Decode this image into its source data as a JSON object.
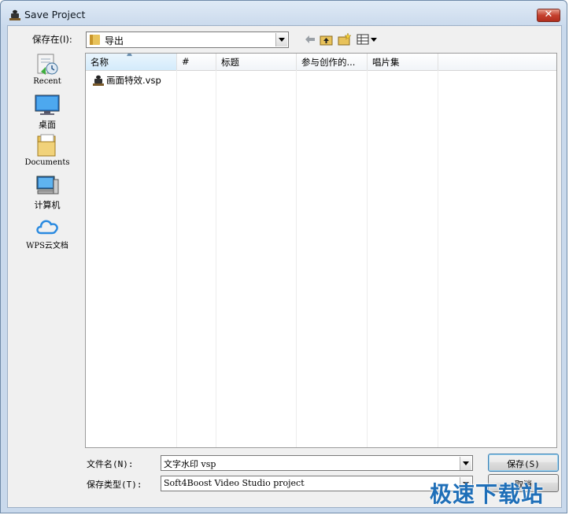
{
  "window": {
    "title": "Save Project"
  },
  "toolbar": {
    "save_in_label": "保存在(I):",
    "current_folder": "导出"
  },
  "places": [
    {
      "label": "Recent",
      "icon": "recent-places-icon"
    },
    {
      "label": "桌面",
      "icon": "desktop-icon"
    },
    {
      "label": "Documents",
      "icon": "documents-folder-icon"
    },
    {
      "label": "计算机",
      "icon": "computer-icon"
    },
    {
      "label": "WPS云文档",
      "icon": "cloud-icon"
    }
  ],
  "columns": [
    {
      "label": "名称",
      "sorted": true
    },
    {
      "label": "#"
    },
    {
      "label": "标题"
    },
    {
      "label": "参与创作的..."
    },
    {
      "label": "唱片集"
    }
  ],
  "files": [
    {
      "name": "画面特效.vsp",
      "icon": "vsp-project-icon"
    }
  ],
  "form": {
    "filename_label": "文件名(N):",
    "filename_value": "文字水印 vsp",
    "filetype_label": "保存类型(T):",
    "filetype_value": "Soft4Boost Video Studio project",
    "save_button": "保存(S)",
    "cancel_button": "取消"
  },
  "watermark": "极速下载站",
  "colors": {
    "title_bar": "#c9d9ec",
    "close_button": "#c4402e",
    "watermark": "#1f6fb8"
  }
}
